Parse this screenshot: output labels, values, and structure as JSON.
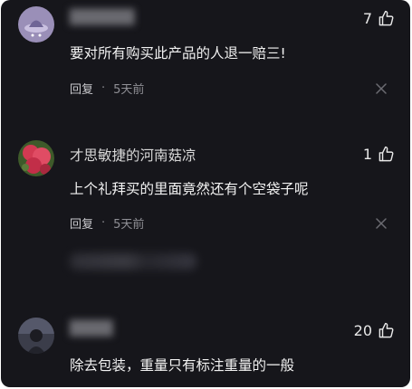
{
  "comments": [
    {
      "username": "",
      "likes": "7",
      "text": "要对所有购买此产品的人退一赔三!",
      "reply_label": "回复",
      "separator": "·",
      "time": "5天前"
    },
    {
      "username": "才思敏捷的河南菇凉",
      "likes": "1",
      "text": "上个礼拜买的里面竟然还有个空袋子呢",
      "reply_label": "回复",
      "separator": "·",
      "time": "5天前"
    },
    {
      "username": "",
      "likes": "20",
      "text": "除去包装，重量只有标注重量的一般"
    }
  ],
  "colors": {
    "background": "#16161b",
    "text": "#f2f2f2",
    "meta": "#8f8f95"
  },
  "icons": {
    "like": "thumbs-up-outline",
    "dismiss": "close-x"
  }
}
